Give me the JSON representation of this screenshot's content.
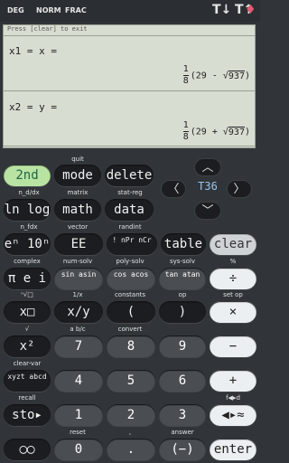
{
  "topbar": {
    "deg": "DEG",
    "norm": "NORM",
    "frac": "FRAC"
  },
  "display": {
    "hint": "Press [clear] to exit",
    "eq1_lhs": "x1 = x =",
    "eq1_num": "1",
    "eq1_den": "8",
    "eq1_expr_a": "(29 - √",
    "eq1_expr_b": "937",
    ")": ")",
    "eq2_lhs": "x2 = y =",
    "eq2_num": "1",
    "eq2_den": "8",
    "eq2_expr_a": "(29 + √",
    "eq2_expr_b": "937"
  },
  "mode_indicator": "T36",
  "buttons": {
    "second": "2nd",
    "mode": "mode",
    "delete": "delete",
    "ln_log": "ln log",
    "math": "math",
    "data": "data",
    "e_pow": "eⁿ 10ⁿ",
    "ee": "EE",
    "npr": "! nPr nCr",
    "table": "table",
    "clear": "clear",
    "pi": "π e i",
    "sin": "sin asin",
    "cos": "cos acos",
    "tan": "tan atan",
    "div": "÷",
    "xsq_root": "x□",
    "x_over_y": "x/y",
    "lparen": "(",
    "rparen": ")",
    "mul": "×",
    "xsq": "x²",
    "n7": "7",
    "n8": "8",
    "n9": "9",
    "minus": "−",
    "xyzt": "xyzt abcd",
    "n4": "4",
    "n5": "5",
    "n6": "6",
    "plus": "+",
    "sto": "sto▸",
    "n1": "1",
    "n2": "2",
    "n3": "3",
    "fd": "◀▸≈",
    "circle": "◯◯",
    "n0": "0",
    "dot": ".",
    "neg": "(−)",
    "enter": "enter"
  },
  "labels": {
    "quit": "quit",
    "n_dx": "n_d/dx",
    "matrix": "matrix",
    "stat_reg": "stat-reg",
    "n_fdx": "n_fdx",
    "vector": "vector",
    "randint": "randint",
    "complex": "complex",
    "num_solv": "num-solv",
    "poly_solv": "poly-solv",
    "sys_solv": "sys-solv",
    "pct": "%",
    "sqrt_lbl": "ⁿ√□",
    "one_over_x": "1/x",
    "constants": "constants",
    "op": "op",
    "set_op": "set op",
    "sqrt": "√",
    "ab_c": "a b/c",
    "convert": "convert",
    "clear_var": "clear-var",
    "recall": "recall",
    "f_d": "f◀▸d",
    "reset": "reset",
    "comma": ",",
    "answer": "answer"
  }
}
